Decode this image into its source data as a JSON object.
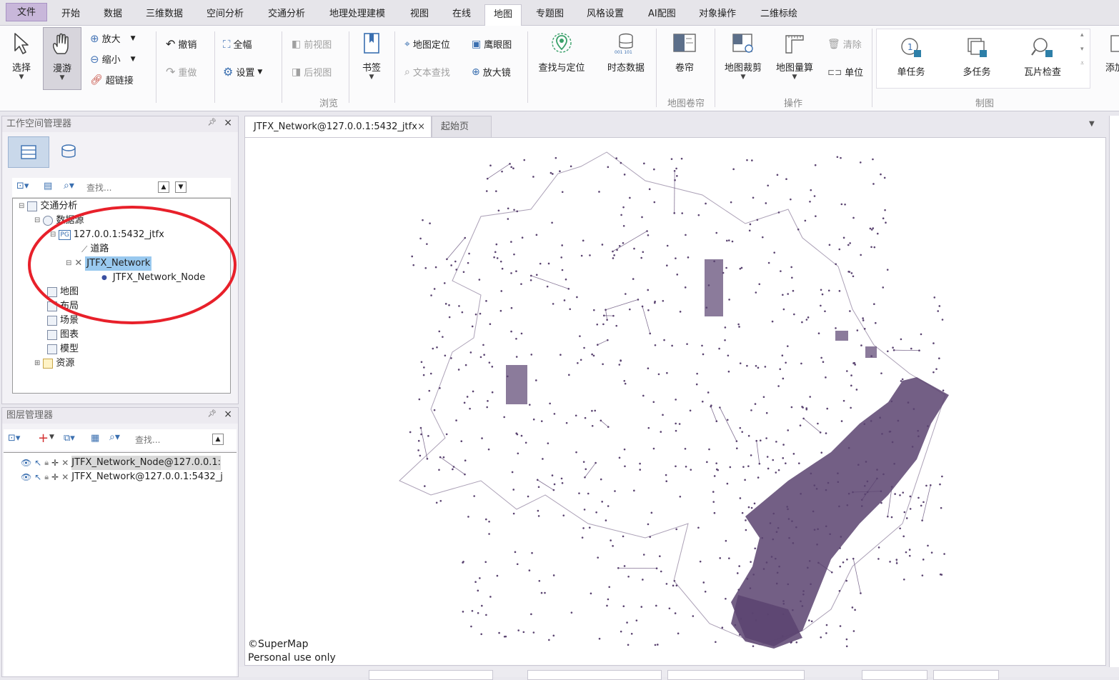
{
  "menu": {
    "items": [
      "文件",
      "开始",
      "数据",
      "三维数据",
      "空间分析",
      "交通分析",
      "地理处理建模",
      "视图",
      "在线",
      "地图",
      "专题图",
      "风格设置",
      "AI配图",
      "对象操作",
      "二维标绘"
    ],
    "active": "地图"
  },
  "ribbon": {
    "select": "选择",
    "pan": "漫游",
    "zoom_in": "放大",
    "zoom_out": "缩小",
    "hyperlink": "超链接",
    "undo": "撤销",
    "redo": "重做",
    "full_extent": "全幅",
    "settings": "设置",
    "prev_view": "前视图",
    "next_view": "后视图",
    "bookmark": "书签",
    "map_locate": "地图定位",
    "eagle_eye": "鹰眼图",
    "text_search": "文本查找",
    "magnifier": "放大镜",
    "find_locate": "查找与定位",
    "temporal": "时态数据",
    "swipe": "卷帘",
    "clip": "地图裁剪",
    "measure": "地图量算",
    "clear": "清除",
    "unit": "单位",
    "single_task": "单任务",
    "multi_task": "多任务",
    "tile_check": "瓦片检查",
    "add": "添加",
    "group_browse": "浏览",
    "group_swipe": "地图卷帘",
    "group_operate": "操作",
    "group_make": "制图"
  },
  "workspace": {
    "title": "工作空间管理器",
    "search_placeholder": "查找...",
    "tree": {
      "root": "交通分析",
      "datasources": "数据源",
      "ds_name": "127.0.0.1:5432_jtfx",
      "ds_badge": "PG",
      "road": "道路",
      "network": "JTFX_Network",
      "network_node": "JTFX_Network_Node",
      "maps": "地图",
      "layouts": "布局",
      "scenes": "场景",
      "charts": "图表",
      "models": "模型",
      "resources": "资源"
    }
  },
  "layers": {
    "title": "图层管理器",
    "search_placeholder": "查找...",
    "items": [
      "JTFX_Network_Node@127.0.0.1:",
      "JTFX_Network@127.0.0.1:5432_j"
    ]
  },
  "tabs": {
    "map_tab": "JTFX_Network@127.0.0.1:5432_jtfx",
    "start_tab": "起始页"
  },
  "map": {
    "copyright": "©SuperMap",
    "license": "Personal use only",
    "line_color": "#5a4370"
  },
  "colors": {
    "accent": "#c8b7da",
    "highlight": "#99c9ef",
    "annotation": "#e8202a"
  }
}
